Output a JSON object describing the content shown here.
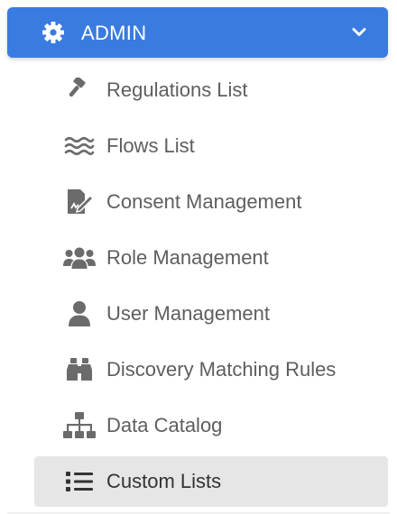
{
  "header": {
    "title": "ADMIN",
    "icon": "gear-icon",
    "toggle_icon": "chevron-down-icon",
    "color": "#3a7be0"
  },
  "menu": {
    "icon_color": "#6b6b6b",
    "active_background": "#e6e6e6",
    "items": [
      {
        "label": "Regulations List",
        "icon": "gavel-icon"
      },
      {
        "label": "Flows List",
        "icon": "water-waves-icon"
      },
      {
        "label": "Consent Management",
        "icon": "file-signature-icon"
      },
      {
        "label": "Role Management",
        "icon": "users-icon"
      },
      {
        "label": "User Management",
        "icon": "user-icon"
      },
      {
        "label": "Discovery Matching Rules",
        "icon": "binoculars-icon"
      },
      {
        "label": "Data Catalog",
        "icon": "sitemap-icon"
      },
      {
        "label": "Custom Lists",
        "icon": "list-icon",
        "active": true
      }
    ]
  }
}
